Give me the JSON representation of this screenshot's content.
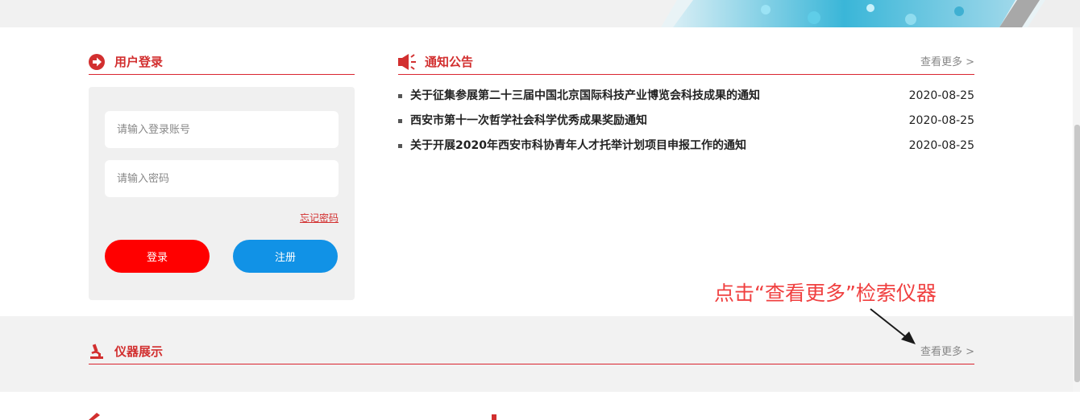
{
  "login": {
    "title": "用户登录",
    "account_placeholder": "请输入登录账号",
    "password_placeholder": "请输入密码",
    "forgot_label": "忘记密码",
    "login_label": "登录",
    "register_label": "注册"
  },
  "notices": {
    "title": "通知公告",
    "more_label": "查看更多 >",
    "items": [
      {
        "title": "关于征集参展第二十三届中国北京国际科技产业博览会科技成果的通知",
        "date": "2020-08-25"
      },
      {
        "title": "西安市第十一次哲学社会科学优秀成果奖励通知",
        "date": "2020-08-25"
      },
      {
        "title": "关于开展2020年西安市科协青年人才托举计划项目申报工作的通知",
        "date": "2020-08-25"
      }
    ]
  },
  "annotation": {
    "text": "点击“查看更多”检索仪器"
  },
  "instruments": {
    "title": "仪器展示",
    "more_label": "查看更多 >"
  },
  "colors": {
    "accent": "#d22f2f",
    "login_button": "#ff0000",
    "register_button": "#1192e6",
    "annotation": "#f04040"
  },
  "icons": {
    "login_icon": "arrow-right-circle-icon",
    "notice_icon": "megaphone-icon",
    "instrument_icon": "microscope-icon"
  }
}
